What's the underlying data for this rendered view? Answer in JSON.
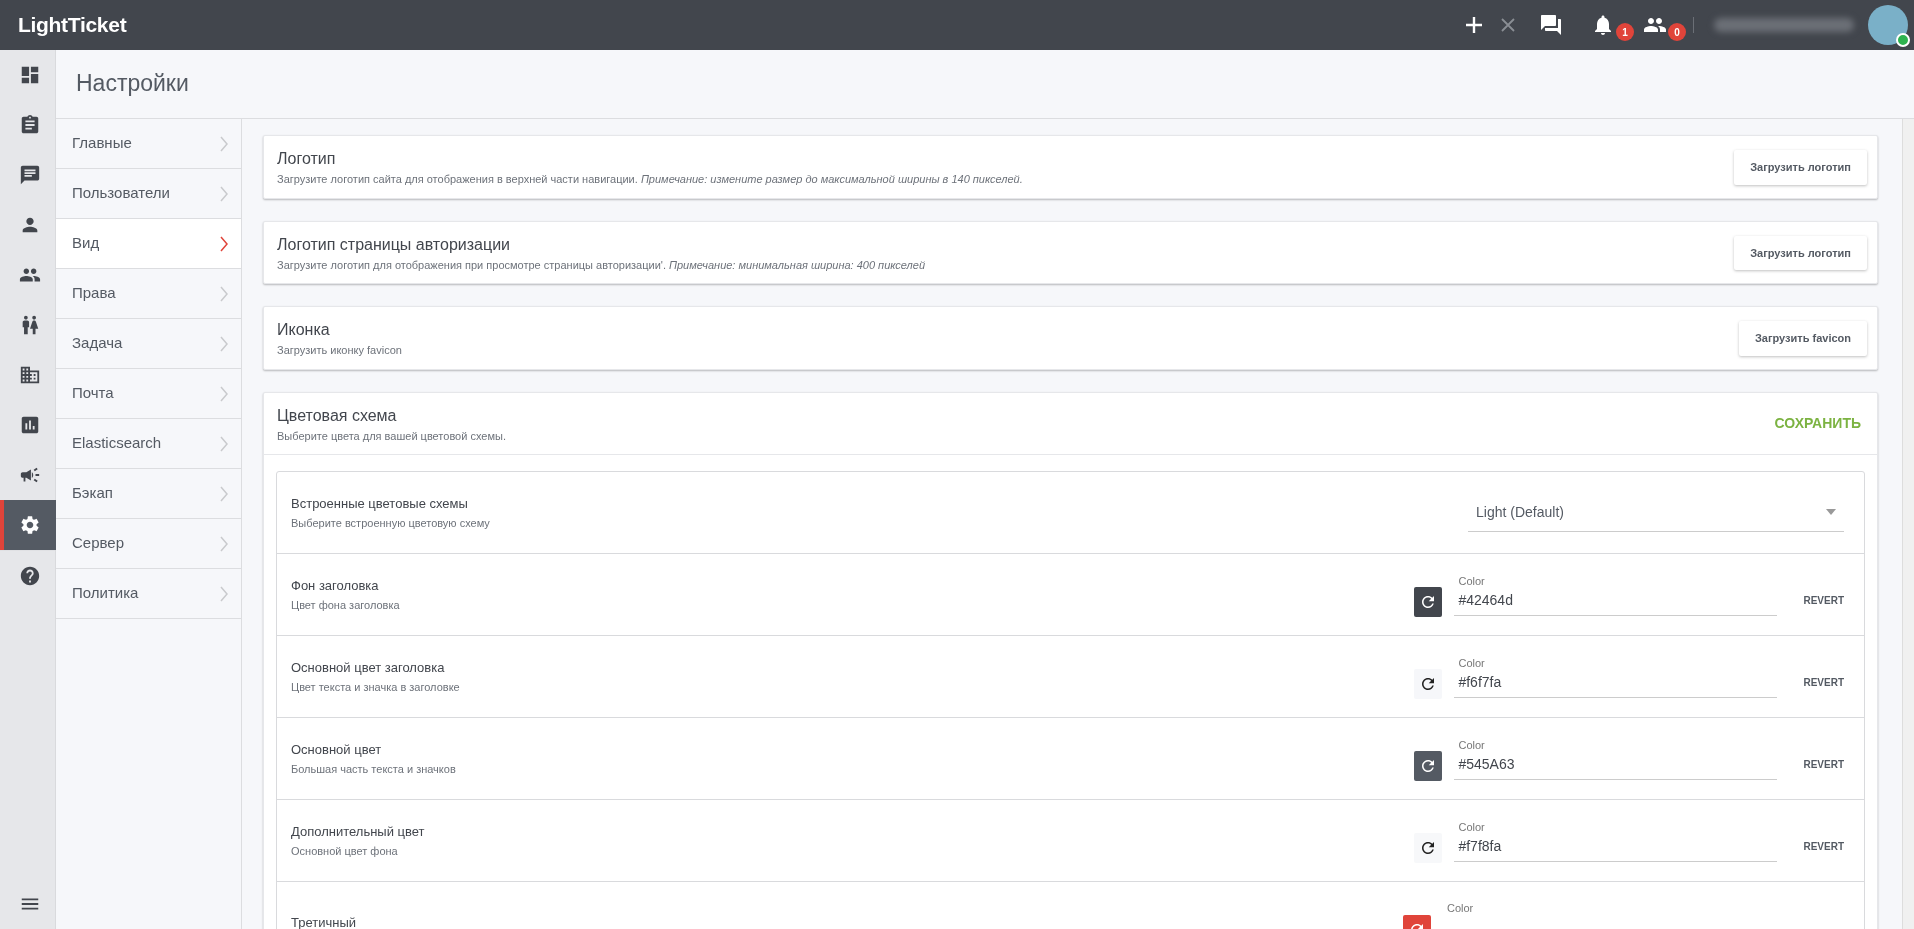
{
  "topbar": {
    "logo": "LightTicket",
    "notifications": {
      "count": "1"
    },
    "contacts": {
      "count": "0"
    }
  },
  "rail": {
    "items": [
      {
        "kind": "dashboard",
        "selected": false
      },
      {
        "kind": "clipboard",
        "selected": false
      },
      {
        "kind": "chat",
        "selected": false
      },
      {
        "kind": "person",
        "selected": false
      },
      {
        "kind": "people",
        "selected": false
      },
      {
        "kind": "man-woman",
        "selected": false
      },
      {
        "kind": "building",
        "selected": false
      },
      {
        "kind": "chart",
        "selected": false
      },
      {
        "kind": "megaphone",
        "selected": false
      },
      {
        "kind": "settings",
        "selected": true
      },
      {
        "kind": "help",
        "selected": false
      }
    ]
  },
  "page_title": "Настройки",
  "submenu": [
    {
      "label": "Главные",
      "selected": false
    },
    {
      "label": "Пользователи",
      "selected": false
    },
    {
      "label": "Вид",
      "selected": true
    },
    {
      "label": "Права",
      "selected": false
    },
    {
      "label": "Задача",
      "selected": false
    },
    {
      "label": "Почта",
      "selected": false
    },
    {
      "label": "Elasticsearch",
      "selected": false
    },
    {
      "label": "Бэкап",
      "selected": false
    },
    {
      "label": "Сервер",
      "selected": false
    },
    {
      "label": "Политика",
      "selected": false
    }
  ],
  "upload_cards": [
    {
      "title": "Логотип",
      "description": "Загрузите логотип сайта для отображения в верхней части навигации. *Примечание: измените размер до максимальной ширины в 140 пикселей.*",
      "button": "Загрузить логотип"
    },
    {
      "title": "Логотип страницы авторизации",
      "description": "Загрузите логотип для отображения при просмотре страницы авторизации'. *Примечание: минимальная ширина: 400 пикселей*",
      "button": "Загрузить логотип"
    },
    {
      "title": "Иконка",
      "description": "Загрузить иконку favicon",
      "button": "Загрузить favicon"
    }
  ],
  "color_scheme": {
    "title": "Цветовая схема",
    "description": "Выберите цвета для вашей цветовой схемы.",
    "save_button": "СОХРАНИТЬ",
    "rows": [
      {
        "kind": "select",
        "title": "Встроенные цветовые схемы",
        "description": "Выберите встроенную цветовую схему",
        "value": "Light (Default)"
      },
      {
        "kind": "color",
        "title": "Фон заголовка",
        "description": "Цвет фона заголовка",
        "field_label": "Color",
        "value": "#42464d",
        "color": "#42464d",
        "revert": "REVERT"
      },
      {
        "kind": "color",
        "title": "Основной цвет заголовка",
        "description": "Цвет текста и значка в заголовке",
        "field_label": "Color",
        "value": "#f6f7fa",
        "color": "#f6f7fa",
        "revert": "REVERT"
      },
      {
        "kind": "color",
        "title": "Основной цвет",
        "description": "Большая часть текста и значков",
        "field_label": "Color",
        "value": "#545A63",
        "color": "#545a63",
        "revert": "REVERT"
      },
      {
        "kind": "color",
        "title": "Дополнительный цвет",
        "description": "Основной цвет фона",
        "field_label": "Color",
        "value": "#f7f8fa",
        "color": "#f7f8fa",
        "revert": "REVERT"
      },
      {
        "kind": "color",
        "title": "Третичный",
        "field_label": "Color",
        "color": "#e0443a"
      }
    ]
  }
}
